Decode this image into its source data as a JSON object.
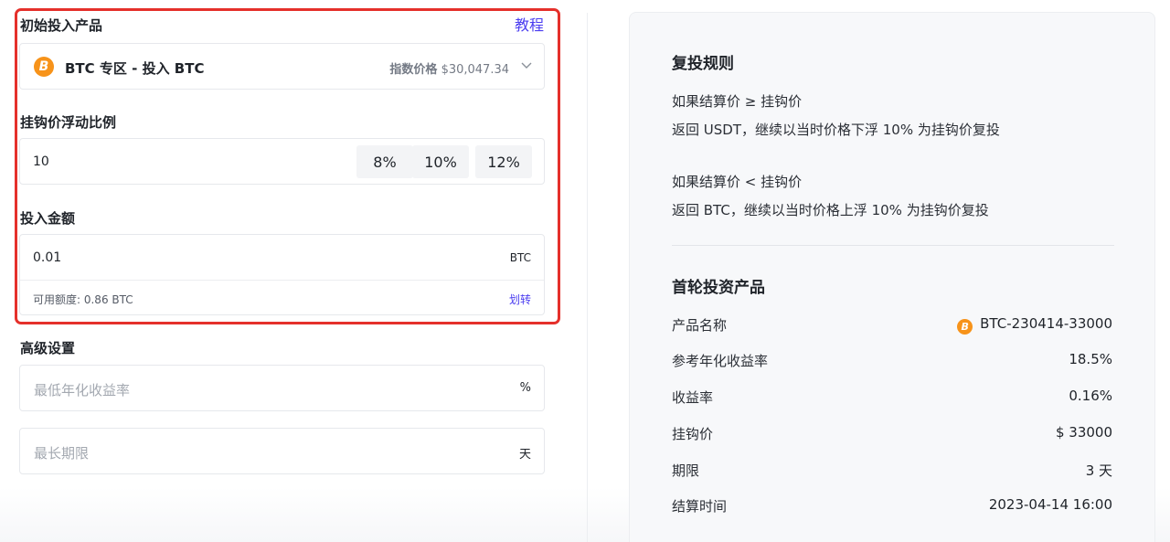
{
  "initial_product": {
    "title": "初始投入产品",
    "tutorial_link": "教程",
    "coin_icon": "bitcoin-icon",
    "product_name": "BTC 专区 - 投入 BTC",
    "index_price_label": "指数价格",
    "index_price_value": "$30,047.34"
  },
  "float_ratio": {
    "title": "挂钩价浮动比例",
    "value": "10",
    "options": [
      "8%",
      "10%",
      "12%"
    ]
  },
  "amount": {
    "title": "投入金额",
    "value": "0.01",
    "unit": "BTC",
    "available": "可用额度: 0.86 BTC",
    "transfer_link": "划转"
  },
  "advanced": {
    "title": "高级设置",
    "min_yield_placeholder": "最低年化收益率",
    "min_yield_unit": "%",
    "max_term_placeholder": "最长期限",
    "max_term_unit": "天"
  },
  "reinvest_rules": {
    "title": "复投规则",
    "rule1_condition": "如果结算价 ≥ 挂钩价",
    "rule1_action": "返回 USDT，继续以当时价格下浮 10% 为挂钩价复投",
    "rule2_condition": "如果结算价 < 挂钩价",
    "rule2_action": "返回 BTC，继续以当时价格上浮 10% 为挂钩价复投"
  },
  "first_round": {
    "title": "首轮投资产品",
    "rows": [
      {
        "label": "产品名称",
        "value": "BTC-230414-33000"
      },
      {
        "label": "参考年化收益率",
        "value": "18.5%"
      },
      {
        "label": "收益率",
        "value": "0.16%"
      },
      {
        "label": "挂钩价",
        "value": "$ 33000"
      },
      {
        "label": "期限",
        "value": "3 天"
      },
      {
        "label": "结算时间",
        "value": "2023-04-14 16:00"
      }
    ]
  },
  "colors": {
    "highlight_border": "#e5302b",
    "link": "#4b3df0",
    "bitcoin": "#f7931a"
  }
}
